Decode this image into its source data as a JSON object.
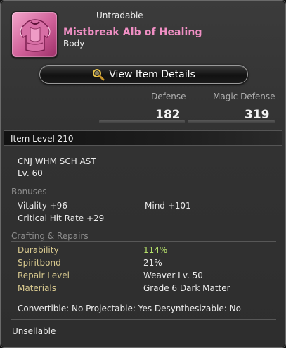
{
  "header": {
    "tradability": "Untradable",
    "name": "Mistbreak Alb of Healing",
    "slot": "Body",
    "icon": "robe-armor-icon"
  },
  "actions": {
    "view_details_label": "View Item Details",
    "view_details_icon": "magnifier-icon"
  },
  "stats": {
    "defense_label": "Defense",
    "defense_value": "182",
    "magic_defense_label": "Magic Defense",
    "magic_defense_value": "319"
  },
  "item_level": "Item Level 210",
  "classes": "CNJ WHM SCH AST",
  "level_req": "Lv. 60",
  "bonuses": {
    "heading": "Bonuses",
    "items": [
      {
        "text": "Vitality +96"
      },
      {
        "text": "Mind +101"
      },
      {
        "text": "Critical Hit Rate +29"
      }
    ]
  },
  "crafting": {
    "heading": "Crafting & Repairs",
    "rows": [
      {
        "label": "Durability",
        "value": "114%"
      },
      {
        "label": "Spiritbond",
        "value": "21%"
      },
      {
        "label": "Repair Level",
        "value": "Weaver Lv. 50"
      },
      {
        "label": "Materials",
        "value": "Grade 6 Dark Matter"
      }
    ]
  },
  "flags": "Convertible: No Projectable: Yes Desynthesizable: No",
  "sellability": "Unsellable",
  "colors": {
    "name": "#f08fc4",
    "durability": "#b6e16b",
    "labels": "#d8c98f"
  }
}
